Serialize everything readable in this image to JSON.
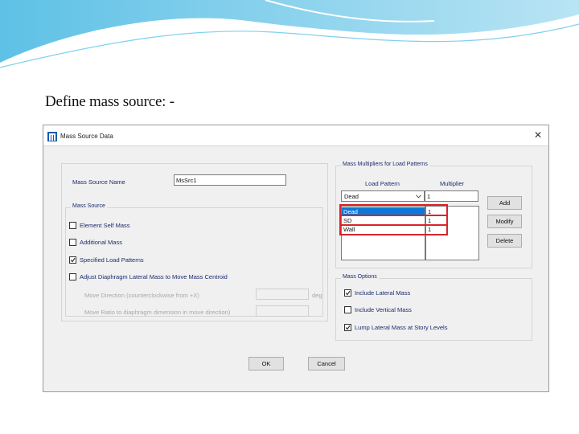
{
  "slide": {
    "heading": "Define mass source: -"
  },
  "dialog": {
    "title": "Mass Source Data",
    "close_glyph": "✕",
    "name_label": "Mass Source Name",
    "name_value": "MsSrc1",
    "mass_source": {
      "legend": "Mass Source",
      "options": [
        {
          "label": "Element Self Mass",
          "checked": false
        },
        {
          "label": "Additional Mass",
          "checked": false
        },
        {
          "label": "Specified Load Patterns",
          "checked": true
        },
        {
          "label": "Adjust Diaphragm Lateral Mass to Move Mass Centroid",
          "checked": false
        }
      ],
      "move_direction_label": "Move Direction (counterclockwise from +X)",
      "move_direction_unit": "deg",
      "move_ratio_label": "Move Ratio to diaphragm dimension in move direction)"
    },
    "multipliers": {
      "legend": "Mass Multipliers for Load Patterns",
      "col_pattern": "Load Pattern",
      "col_multiplier": "Multiplier",
      "dropdown_value": "Dead",
      "multiplier_input": "1",
      "rows": [
        {
          "pattern": "Dead",
          "multiplier": "1",
          "selected": true
        },
        {
          "pattern": "SD",
          "multiplier": "1",
          "selected": false
        },
        {
          "pattern": "Wall",
          "multiplier": "1",
          "selected": false
        }
      ],
      "buttons": {
        "add": "Add",
        "modify": "Modify",
        "delete": "Delete"
      }
    },
    "mass_options": {
      "legend": "Mass Options",
      "options": [
        {
          "label": "Include Lateral Mass",
          "checked": true
        },
        {
          "label": "Include Vertical Mass",
          "checked": false
        },
        {
          "label": "Lump Lateral Mass at Story Levels",
          "checked": true
        }
      ]
    },
    "ok_label": "OK",
    "cancel_label": "Cancel"
  },
  "colors": {
    "accent_blue": "#0b78d7",
    "highlight_red": "#d8242b",
    "label_blue": "#1c2a6e"
  }
}
